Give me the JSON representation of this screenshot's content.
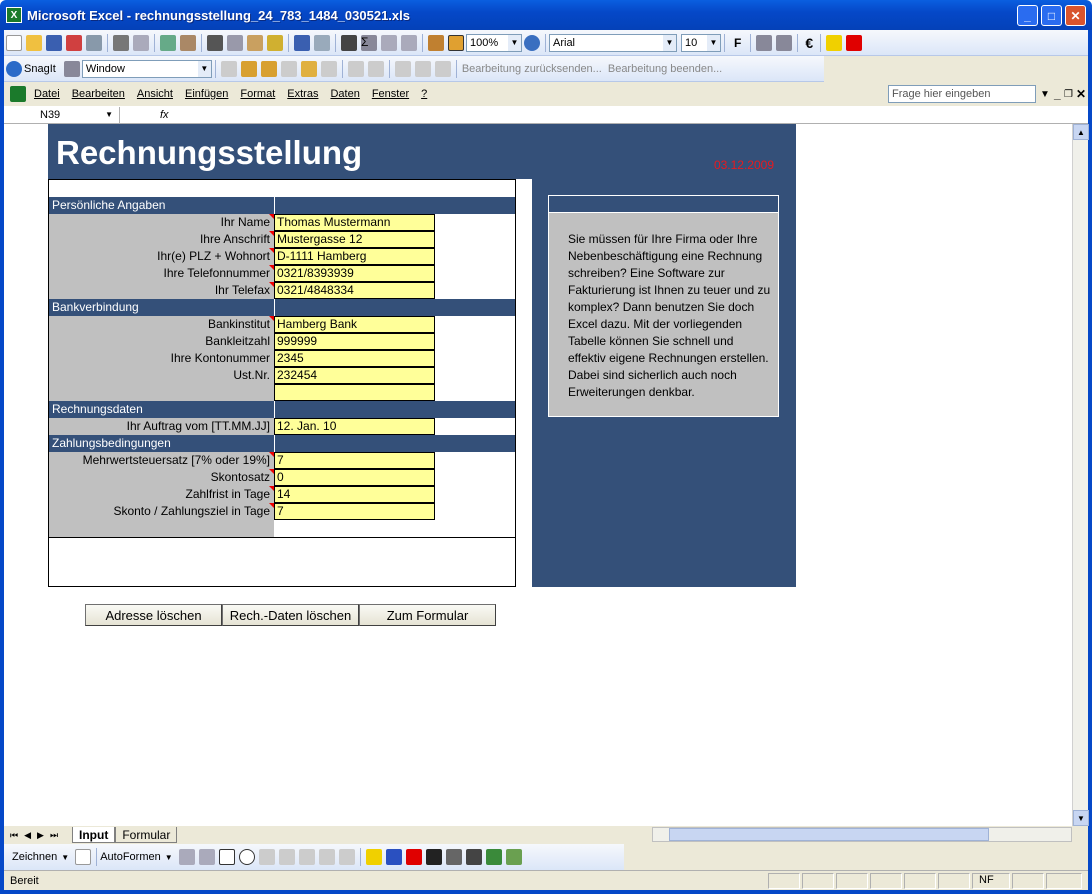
{
  "window": {
    "title": "Microsoft Excel - rechnungsstellung_24_783_1484_030521.xls"
  },
  "toolbar": {
    "zoom": "100%",
    "font": "Arial",
    "size": "10",
    "bold": "F",
    "euro": "€"
  },
  "snagit": {
    "label": "SnagIt",
    "window": "Window",
    "review_send": "Bearbeitung zurücksenden...",
    "review_end": "Bearbeitung beenden..."
  },
  "menu": [
    "Datei",
    "Bearbeiten",
    "Ansicht",
    "Einfügen",
    "Format",
    "Extras",
    "Daten",
    "Fenster",
    "?"
  ],
  "ask": {
    "placeholder": "Frage hier eingeben"
  },
  "formula": {
    "namebox": "N39",
    "fx": "fx"
  },
  "sheet": {
    "title": "Rechnungsstellung",
    "date": "03.12.2009",
    "sections": {
      "personal": "Persönliche Angaben",
      "bank": "Bankverbindung",
      "invoice": "Rechnungsdaten",
      "payment": "Zahlungsbedingungen"
    },
    "personal": [
      {
        "label": "Ihr Name",
        "value": "Thomas Mustermann"
      },
      {
        "label": "Ihre Anschrift",
        "value": "Mustergasse 12"
      },
      {
        "label": "Ihr(e) PLZ + Wohnort",
        "value": "D-1111 Hamberg"
      },
      {
        "label": "Ihre Telefonnummer",
        "value": "0321/8393939"
      },
      {
        "label": "Ihr Telefax",
        "value": "0321/4848334"
      }
    ],
    "bank": [
      {
        "label": "Bankinstitut",
        "value": "Hamberg Bank"
      },
      {
        "label": "Bankleitzahl",
        "value": "999999"
      },
      {
        "label": "Ihre Kontonummer",
        "value": "2345"
      },
      {
        "label": "Ust.Nr.",
        "value": "232454"
      },
      {
        "label": "",
        "value": ""
      }
    ],
    "invoice": [
      {
        "label": "Ihr Auftrag vom [TT.MM.JJ]",
        "value": "12. Jan. 10"
      }
    ],
    "payment": [
      {
        "label": "Mehrwertsteuersatz [7% oder 19%]",
        "value": "7"
      },
      {
        "label": "Skontosatz",
        "value": "0"
      },
      {
        "label": "Zahlfrist in Tage",
        "value": "14"
      },
      {
        "label": "Skonto / Zahlungsziel in Tage",
        "value": "7"
      }
    ],
    "buttons": {
      "clear_address": "Adresse löschen",
      "clear_invoice": "Rech.-Daten löschen",
      "to_form": "Zum Formular"
    },
    "info": "Sie müssen für Ihre Firma oder Ihre Nebenbeschäftigung eine Rechnung schreiben? Eine Software zur Fakturierung ist Ihnen zu teuer und zu komplex? Dann benutzen Sie doch Excel dazu. Mit der vorliegenden Tabelle können Sie schnell und effektiv eigene Rechnungen erstellen. Dabei sind sicherlich auch noch Erweiterungen denkbar."
  },
  "tabs": [
    "Input",
    "Formular"
  ],
  "drawbar": {
    "draw": "Zeichnen",
    "autoshapes": "AutoFormen"
  },
  "status": {
    "ready": "Bereit",
    "nf": "NF"
  }
}
